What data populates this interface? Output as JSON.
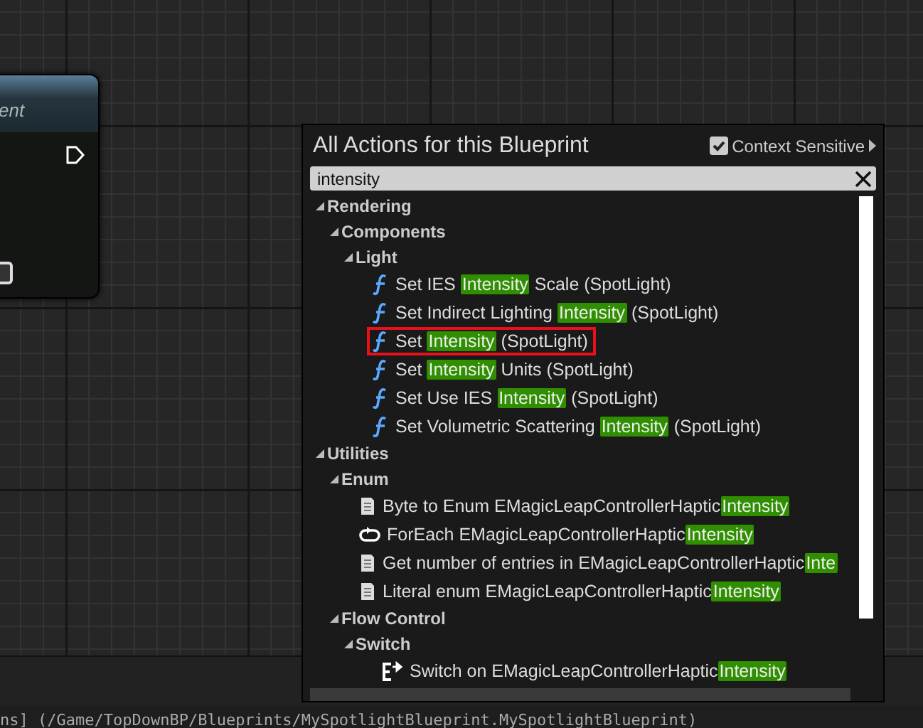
{
  "node": {
    "title": "ent"
  },
  "menu": {
    "title": "All Actions for this Blueprint",
    "context_sensitive": {
      "label": "Context Sensitive",
      "checked": true
    },
    "search": {
      "value": "intensity"
    },
    "tree": [
      {
        "label": "Rendering",
        "expanded": true,
        "children": [
          {
            "label": "Components",
            "expanded": true,
            "children": [
              {
                "label": "Light",
                "expanded": true,
                "children": [
                  {
                    "kind": "function",
                    "prefix": "Set IES ",
                    "match": "Intensity",
                    "suffix": " Scale (SpotLight)",
                    "outlined": false
                  },
                  {
                    "kind": "function",
                    "prefix": "Set Indirect Lighting ",
                    "match": "Intensity",
                    "suffix": " (SpotLight)",
                    "outlined": false
                  },
                  {
                    "kind": "function",
                    "prefix": "Set ",
                    "match": "Intensity",
                    "suffix": " (SpotLight)",
                    "outlined": true
                  },
                  {
                    "kind": "function",
                    "prefix": "Set ",
                    "match": "Intensity",
                    "suffix": " Units (SpotLight)",
                    "outlined": false
                  },
                  {
                    "kind": "function",
                    "prefix": "Set Use IES ",
                    "match": "Intensity",
                    "suffix": " (SpotLight)",
                    "outlined": false
                  },
                  {
                    "kind": "function",
                    "prefix": "Set Volumetric Scattering ",
                    "match": "Intensity",
                    "suffix": " (SpotLight)",
                    "outlined": false
                  }
                ]
              }
            ]
          }
        ]
      },
      {
        "label": "Utilities",
        "expanded": true,
        "children": [
          {
            "label": "Enum",
            "expanded": true,
            "children": [
              {
                "kind": "enum",
                "prefix": "Byte to Enum EMagicLeapControllerHaptic",
                "match": "Intensity",
                "outlined": false
              },
              {
                "kind": "foreach",
                "prefix": "ForEach EMagicLeapControllerHaptic",
                "match": "Intensity",
                "outlined": false
              },
              {
                "kind": "enum",
                "prefix": "Get number of entries in EMagicLeapControllerHaptic",
                "match": "Inte",
                "outlined": false
              },
              {
                "kind": "enum",
                "prefix": "Literal enum EMagicLeapControllerHaptic",
                "match": "Intensity",
                "outlined": false
              }
            ]
          },
          {
            "label": "Flow Control",
            "expanded": true,
            "children": [
              {
                "label": "Switch",
                "expanded": true,
                "children": [
                  {
                    "kind": "switch",
                    "prefix": "Switch on EMagicLeapControllerHaptic",
                    "match": "Intensity",
                    "outlined": false
                  }
                ]
              }
            ]
          }
        ]
      }
    ]
  },
  "status_bar": {
    "path": "ns] (/Game/TopDownBP/Blueprints/MySpotlightBlueprint.MySpotlightBlueprint)"
  }
}
